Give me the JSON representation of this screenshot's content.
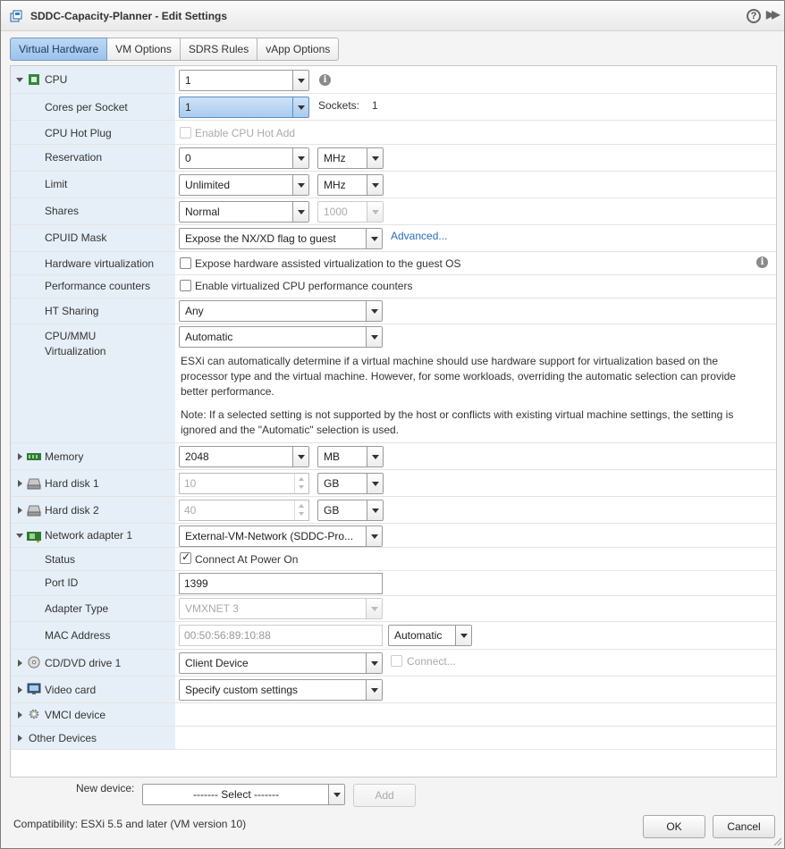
{
  "window": {
    "title": "SDDC-Capacity-Planner - Edit Settings",
    "help_glyph": "?",
    "expand_glyph": "▶▶"
  },
  "tabs": [
    "Virtual Hardware",
    "VM Options",
    "SDRS Rules",
    "vApp Options"
  ],
  "cpu": {
    "label": "CPU",
    "value": "1",
    "info_glyph": "i",
    "cores_per_socket": {
      "label": "Cores per Socket",
      "value": "1",
      "sockets_label": "Sockets:",
      "sockets_value": "1"
    },
    "hot_plug": {
      "label": "CPU Hot Plug",
      "checkbox": "Enable CPU Hot Add"
    },
    "reservation": {
      "label": "Reservation",
      "value": "0",
      "unit": "MHz"
    },
    "limit": {
      "label": "Limit",
      "value": "Unlimited",
      "unit": "MHz"
    },
    "shares": {
      "label": "Shares",
      "value": "Normal",
      "amount": "1000"
    },
    "cpuid_mask": {
      "label": "CPUID Mask",
      "value": "Expose the NX/XD flag to guest",
      "advanced": "Advanced..."
    },
    "hw_virtualization": {
      "label": "Hardware virtualization",
      "checkbox": "Expose hardware assisted virtualization to the guest OS"
    },
    "perf_counters": {
      "label": "Performance counters",
      "checkbox": "Enable virtualized CPU performance counters"
    },
    "ht_sharing": {
      "label": "HT Sharing",
      "value": "Any"
    },
    "cpu_mmu": {
      "label_line1": "CPU/MMU",
      "label_line2": "Virtualization",
      "value": "Automatic",
      "desc1": "ESXi can automatically determine if a virtual machine should use hardware support for virtualization based on the processor type and the virtual machine. However, for some workloads, overriding the automatic selection can provide better performance.",
      "desc2": "Note: If a selected setting is not supported by the host or conflicts with existing virtual machine settings, the setting is ignored and the \"Automatic\" selection is used."
    }
  },
  "memory": {
    "label": "Memory",
    "value": "2048",
    "unit": "MB"
  },
  "hard_disk_1": {
    "label": "Hard disk 1",
    "value": "10",
    "unit": "GB"
  },
  "hard_disk_2": {
    "label": "Hard disk 2",
    "value": "40",
    "unit": "GB"
  },
  "network": {
    "label": "Network adapter 1",
    "value": "External-VM-Network (SDDC-Pro...",
    "status": {
      "label": "Status",
      "checkbox": "Connect At Power On"
    },
    "port_id": {
      "label": "Port ID",
      "value": "1399"
    },
    "adapter_type": {
      "label": "Adapter Type",
      "value": "VMXNET 3"
    },
    "mac": {
      "label": "MAC Address",
      "value": "00:50:56:89:10:88",
      "mode": "Automatic"
    }
  },
  "cd_dvd": {
    "label": "CD/DVD drive 1",
    "value": "Client Device",
    "connect": "Connect..."
  },
  "video_card": {
    "label": "Video card",
    "value": "Specify custom settings"
  },
  "vmci": {
    "label": "VMCI device"
  },
  "other": {
    "label": "Other Devices"
  },
  "footer": {
    "new_device_label": "New device:",
    "new_device_value": "------- Select -------",
    "add": "Add",
    "compatibility": "Compatibility: ESXi 5.5 and later (VM version 10)",
    "ok": "OK",
    "cancel": "Cancel"
  }
}
